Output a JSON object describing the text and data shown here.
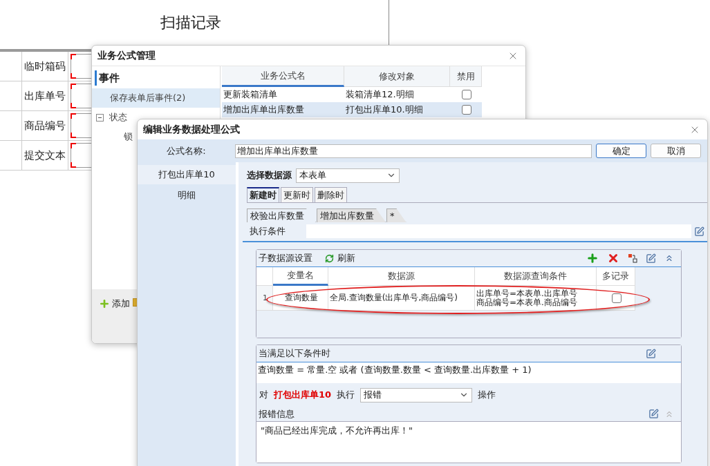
{
  "page": {
    "title": "扫描记录",
    "fields": [
      {
        "label": "临时箱码"
      },
      {
        "label": "出库单号"
      },
      {
        "label": "商品编号"
      },
      {
        "label": "提交文本"
      }
    ]
  },
  "manager": {
    "title": "业务公式管理",
    "heading": "事件",
    "items": [
      {
        "label": "保存表单后事件(2)",
        "selected": true,
        "expanded": false
      },
      {
        "label": "状态",
        "selected": false,
        "expanded": true,
        "children": [
          {
            "label": "锁",
            "selected": false
          }
        ]
      }
    ],
    "columns": [
      "业务公式名",
      "修改对象",
      "禁用"
    ],
    "rows": [
      {
        "name": "更新装箱清单",
        "target": "装箱清单12.明细",
        "disabled": false,
        "selected": false
      },
      {
        "name": "增加出库单出库数量",
        "target": "打包出库单10.明细",
        "disabled": false,
        "selected": true
      }
    ],
    "add_label": "添加"
  },
  "editor": {
    "title": "编辑业务数据处理公式",
    "name_label": "公式名称:",
    "name_value": "增加出库单出库数量",
    "buttons": [
      {
        "label": "确定",
        "default": true
      },
      {
        "label": "取消",
        "default": false
      }
    ],
    "sources": [
      {
        "label": "打包出库单10",
        "selected": true
      },
      {
        "label": "明细",
        "selected": false
      }
    ],
    "source_label": "选择数据源",
    "source_value": "本表单",
    "tabs": [
      {
        "label": "新建时",
        "selected": true
      },
      {
        "label": "更新时",
        "selected": false
      },
      {
        "label": "删除时",
        "selected": false
      }
    ],
    "subtabs": [
      {
        "label": "校验出库数量",
        "selected": true
      },
      {
        "label": "增加出库数量",
        "selected": false
      },
      {
        "label": "*",
        "selected": false
      }
    ],
    "exec_label": "执行条件",
    "subsource": {
      "title": "子数据源设置",
      "refresh": "刷新",
      "columns": [
        "变量名",
        "数据源",
        "数据源查询条件",
        "多记录"
      ],
      "rows": [
        {
          "number": "1",
          "variable": "查询数量",
          "source": "全局.查询数量(出库单号,商品编号)",
          "conditions": [
            "出库单号=本表单.出库单号",
            "商品编号=本表单.商品编号"
          ],
          "multi": false
        }
      ]
    },
    "condition": {
      "title": "当满足以下条件时",
      "expression": "查询数量 = 常量.空 或者 (查询数量.数量  <  查询数量.出库数量 + 1)",
      "prefix": "对",
      "target": "打包出库单10",
      "middle": "执行",
      "action": "报错",
      "suffix": "操作",
      "message_label": "报错信息",
      "message": "\"商品已经出库完成，不允许再出库！\""
    }
  }
}
